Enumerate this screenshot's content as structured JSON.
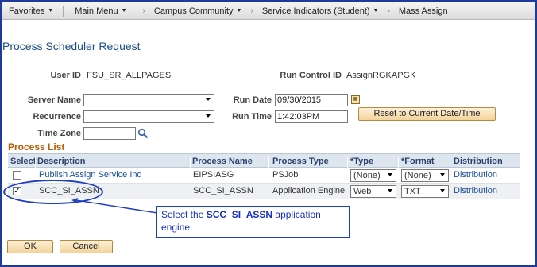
{
  "nav": {
    "favorites": "Favorites",
    "main_menu": "Main Menu",
    "crumbs": [
      "Campus Community",
      "Service Indicators (Student)",
      "Mass Assign"
    ]
  },
  "page_title": "Process Scheduler Request",
  "user_id_label": "User ID",
  "user_id_value": "FSU_SR_ALLPAGES",
  "run_control_label": "Run Control ID",
  "run_control_value": "AssignRGKAPGK",
  "server_name_label": "Server Name",
  "recurrence_label": "Recurrence",
  "time_zone_label": "Time Zone",
  "run_date_label": "Run Date",
  "run_date_value": "09/30/2015",
  "run_time_label": "Run Time",
  "run_time_value": "1:42:03PM",
  "reset_button": "Reset to Current Date/Time",
  "process_list": {
    "title": "Process List",
    "columns": [
      "Select",
      "Description",
      "Process Name",
      "Process Type",
      "*Type",
      "*Format",
      "Distribution"
    ],
    "rows": [
      {
        "selected": false,
        "description": "Publish Assign Service Ind",
        "process_name": "EIPSIASG",
        "process_type": "PSJob",
        "type": "(None)",
        "format": "(None)",
        "distribution": "Distribution"
      },
      {
        "selected": true,
        "description": "SCC_SI_ASSN",
        "process_name": "SCC_SI_ASSN",
        "process_type": "Application Engine",
        "type": "Web",
        "format": "TXT",
        "distribution": "Distribution"
      }
    ]
  },
  "callout": {
    "prefix": "Select the ",
    "bold": "SCC_SI_ASSN",
    "suffix": " application engine."
  },
  "ok_button": "OK",
  "cancel_button": "Cancel",
  "colors": {
    "frame": "#1e3a9e",
    "title": "#1c4d8c",
    "link": "#1a4f9c",
    "section": "#b45f06",
    "annotation": "#1f3fbf"
  }
}
